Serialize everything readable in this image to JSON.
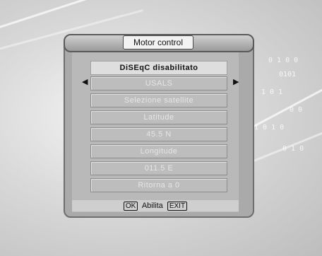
{
  "window": {
    "title": "Motor control"
  },
  "menu": {
    "header": "DiSEqC disabilitato",
    "items": [
      {
        "label": "USALS"
      },
      {
        "label": "Selezione satellite"
      },
      {
        "label": "Latitude"
      },
      {
        "label": "45.5  N"
      },
      {
        "label": "Longitude"
      },
      {
        "label": "011.5  E"
      },
      {
        "label": "Ritorna a 0"
      }
    ]
  },
  "footer": {
    "ok_key": "OK",
    "action_label": "Abilita",
    "exit_key": "EXIT"
  },
  "icons": {
    "left": "triangle-left-icon",
    "right": "triangle-right-icon"
  }
}
